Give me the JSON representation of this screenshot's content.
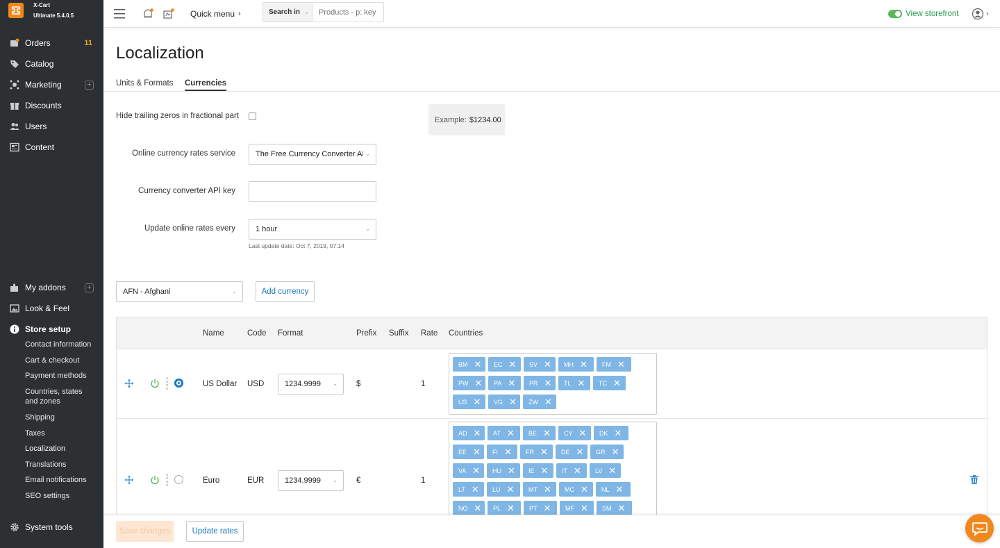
{
  "app": {
    "name": "X-Cart",
    "version": "Ultimate 5.4.0.5",
    "logo_glyph": "✕"
  },
  "sidebar": {
    "items": [
      {
        "label": "Orders",
        "icon": "orders-icon",
        "badge": "11"
      },
      {
        "label": "Catalog",
        "icon": "tag-icon"
      },
      {
        "label": "Marketing",
        "icon": "marketing-icon",
        "expandable": true
      },
      {
        "label": "Discounts",
        "icon": "gift-icon"
      },
      {
        "label": "Users",
        "icon": "users-icon"
      },
      {
        "label": "Content",
        "icon": "content-icon"
      },
      {
        "label": "My addons",
        "icon": "puzzle-icon",
        "expandable": true
      },
      {
        "label": "Look & Feel",
        "icon": "image-icon"
      },
      {
        "label": "Store setup",
        "icon": "info-icon",
        "active": true
      },
      {
        "label": "System tools",
        "icon": "gear-icon"
      }
    ],
    "store_setup_sub": [
      "Contact information",
      "Cart & checkout",
      "Payment methods",
      "Countries, states and zones",
      "Shipping",
      "Taxes",
      "Localization",
      "Translations",
      "Email notifications",
      "SEO settings"
    ]
  },
  "topbar": {
    "quick_menu": "Quick menu",
    "search_scope": "Search in",
    "search_placeholder": "Products - p: key",
    "view_storefront": "View storefront"
  },
  "page": {
    "title": "Localization",
    "tabs": [
      {
        "label": "Units & Formats",
        "active": false
      },
      {
        "label": "Currencies",
        "active": true
      }
    ]
  },
  "form": {
    "hide_zeros_label": "Hide trailing zeros in fractional part",
    "example_label": "Example:",
    "example_value": "$1234.00",
    "rates_service_label": "Online currency rates service",
    "rates_service_value": "The Free Currency Converter AP",
    "api_key_label": "Currency converter API key",
    "api_key_value": "",
    "update_every_label": "Update online rates every",
    "update_every_value": "1 hour",
    "last_update": "Last update date: Oct 7, 2019, 07:14"
  },
  "add_currency": {
    "select_value": "AFN - Afghani",
    "button_label": "Add currency"
  },
  "table": {
    "headers": [
      "Name",
      "Code",
      "Format",
      "Prefix",
      "Suffix",
      "Rate",
      "Countries"
    ],
    "rows": [
      {
        "name": "US Dollar",
        "code": "USD",
        "format": "1234.9999",
        "prefix": "$",
        "suffix": "",
        "rate": "1",
        "default": true,
        "countries": [
          [
            "BM",
            "EC",
            "SV",
            "MH",
            "FM"
          ],
          [
            "PW",
            "PA",
            "PR",
            "TL",
            "TC"
          ],
          [
            "US",
            "VG",
            "ZW"
          ]
        ]
      },
      {
        "name": "Euro",
        "code": "EUR",
        "format": "1234.9999",
        "prefix": "€",
        "suffix": "",
        "rate": "1",
        "default": false,
        "countries": [
          [
            "AD",
            "AT",
            "BE",
            "CY",
            "DK"
          ],
          [
            "EE",
            "FI",
            "FR",
            "DE",
            "GR"
          ],
          [
            "VA",
            "HU",
            "IE",
            "IT",
            "LV"
          ],
          [
            "LT",
            "LU",
            "MT",
            "MC",
            "NL"
          ],
          [
            "NO",
            "PL",
            "PT",
            "MF",
            "SM"
          ]
        ]
      }
    ]
  },
  "footer": {
    "save_label": "Save changes",
    "update_rates_label": "Update rates"
  },
  "colors": {
    "accent": "#1a78c2",
    "brand": "#f0881d",
    "chip": "#7fb6e5",
    "toggle_green": "#5cb85c"
  }
}
